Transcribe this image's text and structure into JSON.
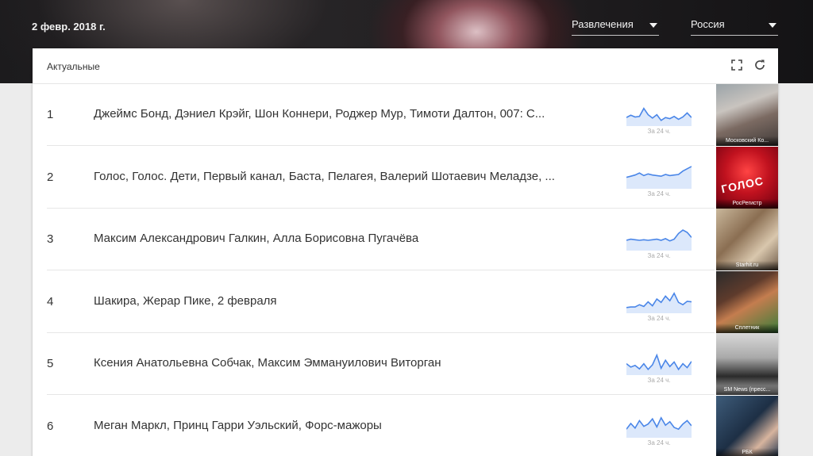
{
  "header": {
    "date": "2 февр. 2018 г.",
    "category": {
      "label": "Развлечения"
    },
    "region": {
      "label": "Россия"
    }
  },
  "card": {
    "title": "Актуальные",
    "icons": [
      "fullscreen-icon",
      "refresh-icon"
    ]
  },
  "colors": {
    "spark_line": "#4a86e8",
    "spark_fill": "#dce8fb",
    "accent_voice": "#d0021b"
  },
  "rows": [
    {
      "rank": "1",
      "title": "Джеймс Бонд, Дэниел Крэйг, Шон Коннери, Роджер Мур, Тимоти Далтон, 007: С...",
      "caption": "За 24 ч.",
      "spark": [
        30,
        38,
        32,
        34,
        62,
        40,
        28,
        40,
        20,
        30,
        26,
        34,
        24,
        32,
        46,
        30
      ],
      "thumb_source": "Московский Ко..."
    },
    {
      "rank": "2",
      "title": "Голос, Голос. Дети, Первый канал, Баста, Пелагея, Валерий Шотаевич Меладзе, ...",
      "caption": "За 24 ч.",
      "spark": [
        40,
        44,
        48,
        55,
        46,
        52,
        48,
        46,
        44,
        50,
        46,
        48,
        50,
        62,
        70,
        78
      ],
      "thumb_source": "РосРегистр",
      "thumb_text": "ГОЛОС"
    },
    {
      "rank": "3",
      "title": "Максим Александрович Галкин, Алла Борисовна Пугачёва",
      "caption": "За 24 ч.",
      "spark": [
        36,
        40,
        38,
        36,
        38,
        36,
        38,
        40,
        36,
        42,
        34,
        40,
        60,
        72,
        64,
        46
      ],
      "thumb_source": "Starhit.ru"
    },
    {
      "rank": "4",
      "title": "Шакира, Жерар Пике, 2 февраля",
      "caption": "За 24 ч.",
      "spark": [
        20,
        22,
        22,
        30,
        24,
        40,
        26,
        50,
        38,
        60,
        44,
        70,
        38,
        30,
        42,
        40
      ],
      "thumb_source": "Сплетник"
    },
    {
      "rank": "5",
      "title": "Ксения Анатольевна Собчак, Максим Эммануилович Виторган",
      "caption": "За 24 ч.",
      "spark": [
        40,
        28,
        34,
        22,
        40,
        20,
        36,
        70,
        24,
        52,
        30,
        46,
        20,
        40,
        26,
        48
      ],
      "thumb_source": "SM News (пресс..."
    },
    {
      "rank": "6",
      "title": "Меган Маркл, Принц Гарри Уэльский, Форс-мажоры",
      "caption": "За 24 ч.",
      "spark": [
        30,
        50,
        34,
        60,
        40,
        48,
        66,
        38,
        70,
        44,
        56,
        36,
        30,
        48,
        60,
        42
      ],
      "thumb_source": "РБК"
    }
  ]
}
